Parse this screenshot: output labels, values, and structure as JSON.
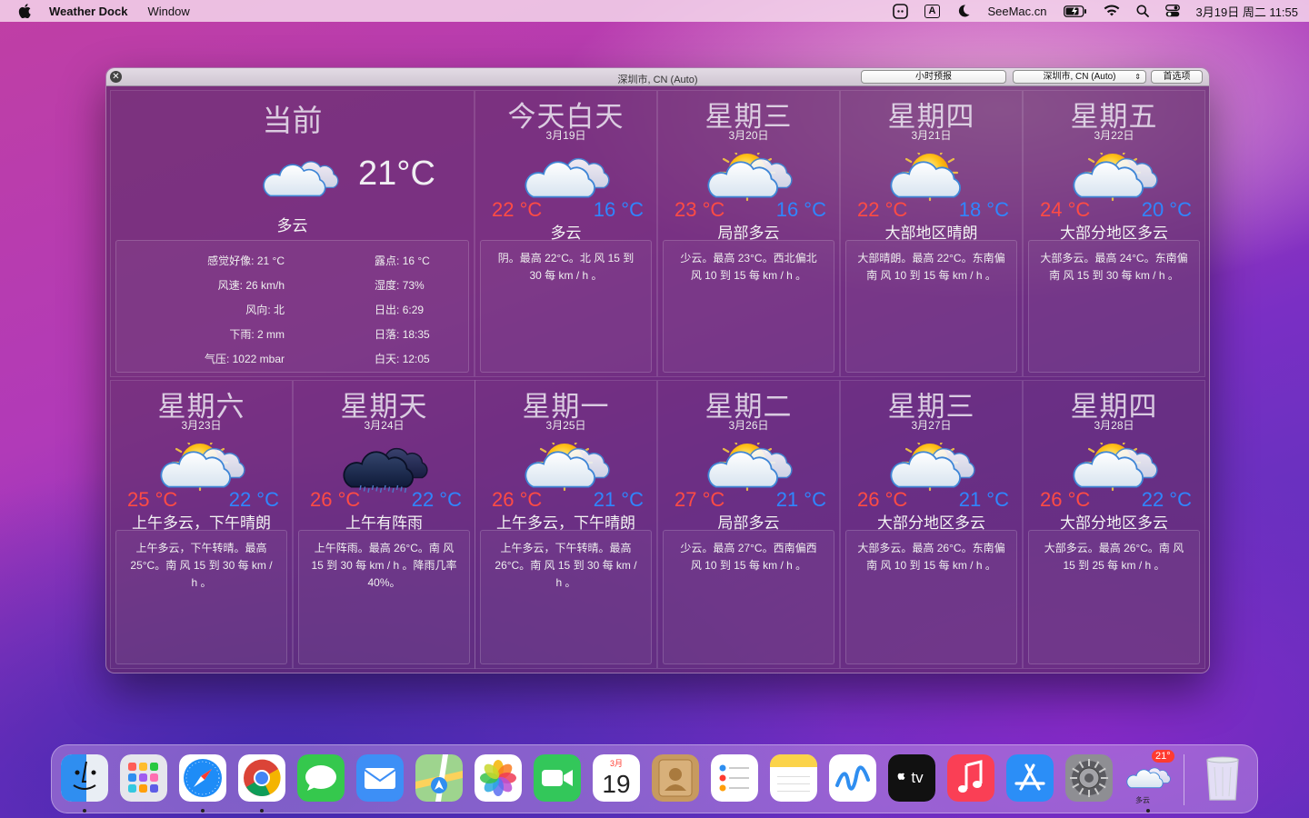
{
  "menubar": {
    "app_name": "Weather Dock",
    "menu_window": "Window",
    "input_indicator": "A",
    "site": "SeeMac.cn",
    "datetime": "3月19日 周二  11:55"
  },
  "window": {
    "title": "深圳市, CN (Auto)",
    "hourly_button": "小时预报",
    "location_select": "深圳市, CN (Auto)",
    "prefs_button": "首选项"
  },
  "current": {
    "title": "当前",
    "temp": "21°C",
    "condition": "多云",
    "details_left": [
      {
        "label": "感觉好像",
        "value": "21 °C"
      },
      {
        "label": "风速",
        "value": "26 km/h"
      },
      {
        "label": "风向",
        "value": "北"
      },
      {
        "label": "下雨",
        "value": "2 mm"
      },
      {
        "label": "气压",
        "value": "1022 mbar"
      }
    ],
    "details_right": [
      {
        "label": "露点",
        "value": "16 °C"
      },
      {
        "label": "湿度",
        "value": "73%"
      },
      {
        "label": "日出",
        "value": "6:29"
      },
      {
        "label": "日落",
        "value": "18:35"
      },
      {
        "label": "白天",
        "value": "12:05"
      }
    ]
  },
  "days": [
    {
      "name": "今天白天",
      "date": "3月19日",
      "hi": "22 °C",
      "lo": "16 °C",
      "cond": "多云",
      "icon": "cloudy-icon",
      "desc": "阴。最高 22°C。北 风 15 到 30 每 km / h 。"
    },
    {
      "name": "星期三",
      "date": "3月20日",
      "hi": "23 °C",
      "lo": "16 °C",
      "cond": "局部多云",
      "icon": "partly-cloudy-icon",
      "desc": "少云。最高 23°C。西北偏北 风 10 到 15 每 km / h 。"
    },
    {
      "name": "星期四",
      "date": "3月21日",
      "hi": "22 °C",
      "lo": "18 °C",
      "cond": "大部地区晴朗",
      "icon": "mostly-sunny-icon",
      "desc": "大部晴朗。最高 22°C。东南偏南 风 10 到 15 每 km / h 。"
    },
    {
      "name": "星期五",
      "date": "3月22日",
      "hi": "24 °C",
      "lo": "20 °C",
      "cond": "大部分地区多云",
      "icon": "mostly-cloudy-icon",
      "desc": "大部多云。最高 24°C。东南偏南 风 15 到 30 每 km / h 。"
    },
    {
      "name": "星期六",
      "date": "3月23日",
      "hi": "25 °C",
      "lo": "22 °C",
      "cond": "上午多云，下午晴朗",
      "icon": "partly-cloudy-icon",
      "desc": "上午多云，下午转晴。最高 25°C。南 风 15 到 30 每 km / h 。"
    },
    {
      "name": "星期天",
      "date": "3月24日",
      "hi": "26 °C",
      "lo": "22 °C",
      "cond": "上午有阵雨",
      "icon": "rain-cloud-icon",
      "desc": "上午阵雨。最高 26°C。南 风 15 到 30 每 km / h 。降雨几率 40%。"
    },
    {
      "name": "星期一",
      "date": "3月25日",
      "hi": "26 °C",
      "lo": "21 °C",
      "cond": "上午多云，下午晴朗",
      "icon": "partly-cloudy-icon",
      "desc": "上午多云，下午转晴。最高 26°C。南 风 15 到 30 每 km / h 。"
    },
    {
      "name": "星期二",
      "date": "3月26日",
      "hi": "27 °C",
      "lo": "21 °C",
      "cond": "局部多云",
      "icon": "partly-cloudy-icon",
      "desc": "少云。最高 27°C。西南偏西 风 10 到 15 每 km / h 。"
    },
    {
      "name": "星期三",
      "date": "3月27日",
      "hi": "26 °C",
      "lo": "21 °C",
      "cond": "大部分地区多云",
      "icon": "mostly-cloudy-icon",
      "desc": "大部多云。最高 26°C。东南偏南 风 10 到 15 每 km / h 。"
    },
    {
      "name": "星期四",
      "date": "3月28日",
      "hi": "26 °C",
      "lo": "22 °C",
      "cond": "大部分地区多云",
      "icon": "mostly-cloudy-icon",
      "desc": "大部多云。最高 26°C。南 风 15 到 25 每 km / h 。"
    }
  ],
  "dock": {
    "items": [
      {
        "name": "finder-icon",
        "color": "#3d9bf5",
        "running": true
      },
      {
        "name": "launchpad-icon",
        "color": "#e9e9ef",
        "running": false
      },
      {
        "name": "safari-icon",
        "color": "#ffffff",
        "running": true
      },
      {
        "name": "chrome-icon",
        "color": "#ffffff",
        "running": true
      },
      {
        "name": "messages-icon",
        "color": "#35c84d",
        "running": false
      },
      {
        "name": "mail-icon",
        "color": "#3d8ff6",
        "running": false
      },
      {
        "name": "maps-icon",
        "color": "#8fd18a",
        "running": false
      },
      {
        "name": "photos-icon",
        "color": "#ffffff",
        "running": false
      },
      {
        "name": "facetime-icon",
        "color": "#33c75a",
        "running": false
      },
      {
        "name": "calendar-icon",
        "color": "#ffffff",
        "running": false
      },
      {
        "name": "contacts-icon",
        "color": "#c79a5f",
        "running": false
      },
      {
        "name": "reminders-icon",
        "color": "#ffffff",
        "running": false
      },
      {
        "name": "notes-icon",
        "color": "#fbe07a",
        "running": false
      },
      {
        "name": "freeform-icon",
        "color": "#ffffff",
        "running": false
      },
      {
        "name": "appletv-icon",
        "color": "#111111",
        "running": false
      },
      {
        "name": "music-icon",
        "color": "#fa3f55",
        "running": false
      },
      {
        "name": "appstore-icon",
        "color": "#2b8ef7",
        "running": false
      },
      {
        "name": "system-settings-icon",
        "color": "#8e8e93",
        "running": false
      },
      {
        "name": "weather-dock-icon",
        "color": "transparent",
        "running": true
      }
    ],
    "calendar_month": "3月",
    "calendar_day": "19",
    "appletv_label": "tv",
    "weather_badge": "21°",
    "weather_label": "多云"
  }
}
